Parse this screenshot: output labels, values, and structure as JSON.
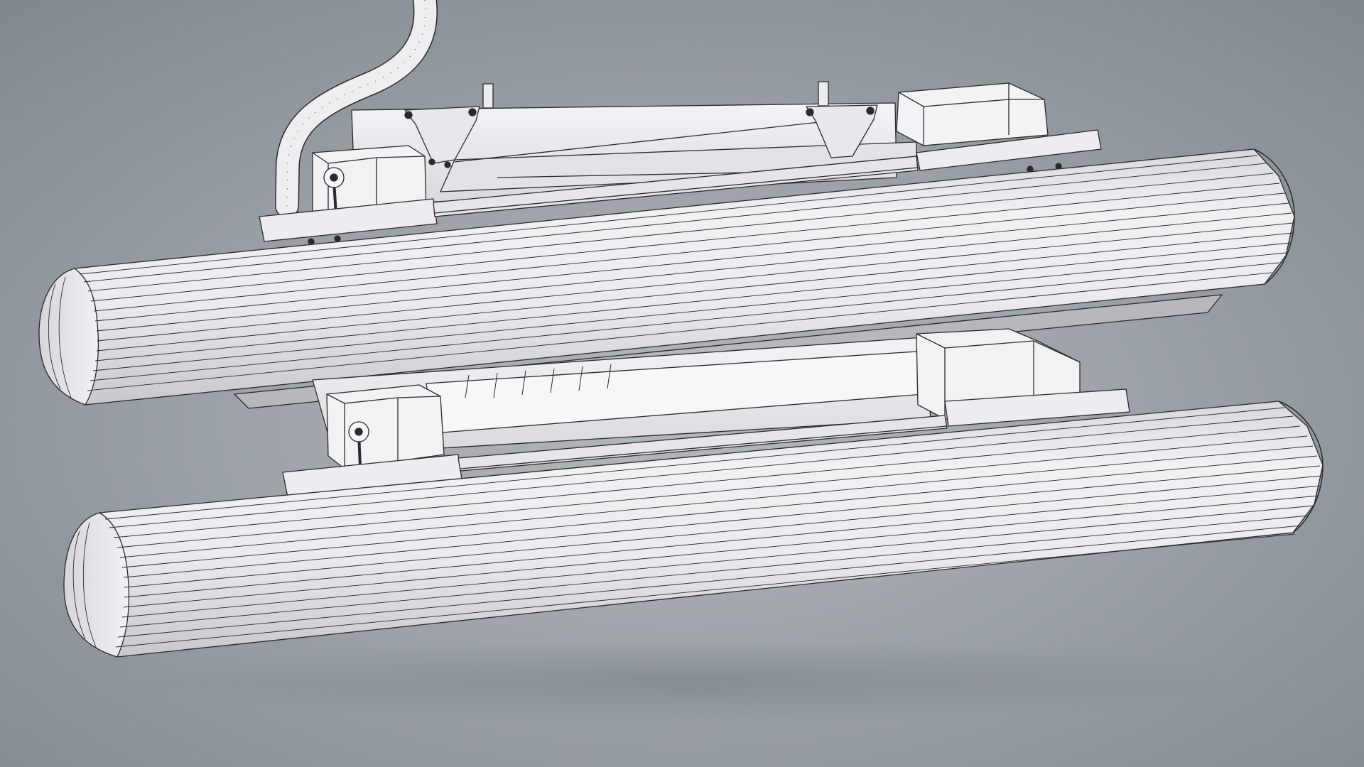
{
  "scene": {
    "subject": "wireframe-render",
    "colors": {
      "background_center": "#b3b8bc",
      "background_edge": "#7f878d",
      "model_fill": "#efeef1",
      "model_shade": "#cfcdd3",
      "model_dark": "#b4b2b9",
      "wire": "#2a2a2e"
    }
  }
}
